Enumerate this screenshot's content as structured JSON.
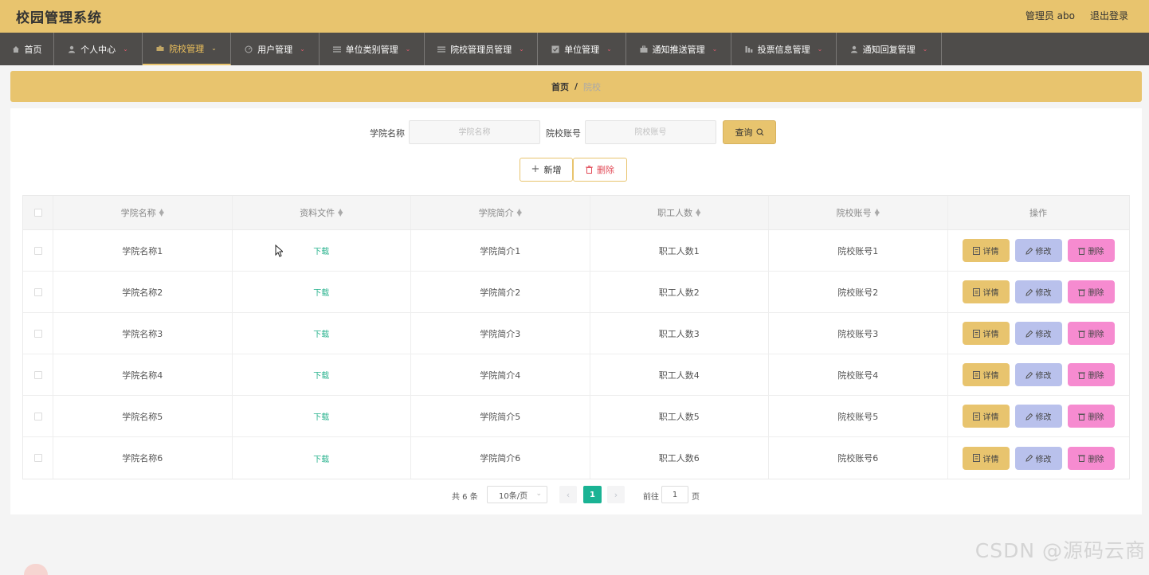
{
  "app": {
    "title": "校园管理系统",
    "admin": "管理员 abo",
    "logout": "退出登录"
  },
  "nav": [
    {
      "label": "首页",
      "icon": "home-icon",
      "caret": false,
      "active": false,
      "width": 68
    },
    {
      "label": "个人中心",
      "icon": "user-icon",
      "caret": true,
      "active": false,
      "width": 111
    },
    {
      "label": "院校管理",
      "icon": "school-icon",
      "caret": true,
      "active": true,
      "width": 111
    },
    {
      "label": "用户管理",
      "icon": "gauge-icon",
      "caret": true,
      "active": false,
      "width": 111
    },
    {
      "label": "单位类别管理",
      "icon": "list-icon",
      "caret": true,
      "active": false,
      "width": 132
    },
    {
      "label": "院校管理员管理",
      "icon": "list-icon",
      "caret": true,
      "active": false,
      "width": 142
    },
    {
      "label": "单位管理",
      "icon": "checkbox-icon",
      "caret": true,
      "active": false,
      "width": 111
    },
    {
      "label": "通知推送管理",
      "icon": "briefcase-icon",
      "caret": true,
      "active": false,
      "width": 132
    },
    {
      "label": "投票信息管理",
      "icon": "bar-chart-icon",
      "caret": true,
      "active": false,
      "width": 132
    },
    {
      "label": "通知回复管理",
      "icon": "user-icon",
      "caret": true,
      "active": false,
      "width": 132
    }
  ],
  "breadcrumb": {
    "home": "首页",
    "separator": "/",
    "current": "院校"
  },
  "search": {
    "college_label": "学院名称",
    "college_placeholder": "学院名称",
    "account_label": "院校账号",
    "account_placeholder": "院校账号",
    "query_label": "查询"
  },
  "actions": {
    "add_label": "新增",
    "delete_label": "删除"
  },
  "table": {
    "headers": [
      "学院名称",
      "资料文件",
      "学院简介",
      "职工人数",
      "院校账号",
      "操作"
    ],
    "rows": [
      {
        "name": "学院名称1",
        "file": "下载",
        "intro": "学院简介1",
        "staff": "职工人数1",
        "account": "院校账号1"
      },
      {
        "name": "学院名称2",
        "file": "下载",
        "intro": "学院简介2",
        "staff": "职工人数2",
        "account": "院校账号2"
      },
      {
        "name": "学院名称3",
        "file": "下载",
        "intro": "学院简介3",
        "staff": "职工人数3",
        "account": "院校账号3"
      },
      {
        "name": "学院名称4",
        "file": "下载",
        "intro": "学院简介4",
        "staff": "职工人数4",
        "account": "院校账号4"
      },
      {
        "name": "学院名称5",
        "file": "下载",
        "intro": "学院简介5",
        "staff": "职工人数5",
        "account": "院校账号5"
      },
      {
        "name": "学院名称6",
        "file": "下载",
        "intro": "学院简介6",
        "staff": "职工人数6",
        "account": "院校账号6"
      }
    ],
    "op_detail": "详情",
    "op_edit": "修改",
    "op_delete": "删除"
  },
  "pagination": {
    "total": "共 6 条",
    "page_size": "10条/页",
    "current": "1",
    "goto": "前往",
    "goto_value": "1",
    "page_suffix": "页"
  },
  "watermark": "CSDN @源码云商",
  "colors": {
    "header": "#e8c46e",
    "nav": "#4e4c4a",
    "accent": "#1ab394",
    "detail": "#e8c46e",
    "edit": "#b9c1ec",
    "delete": "#f68bd0"
  }
}
